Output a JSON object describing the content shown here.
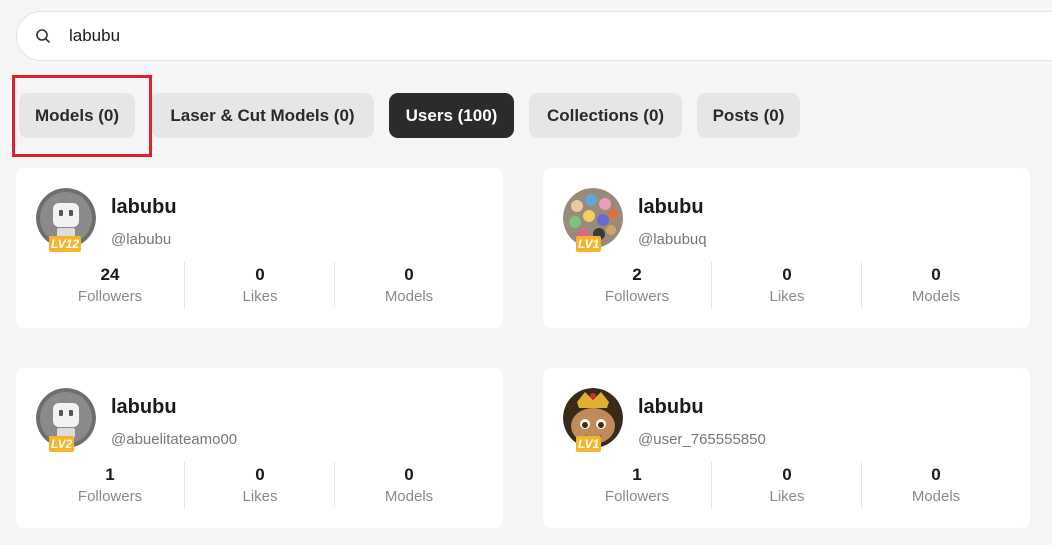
{
  "search": {
    "value": "labubu"
  },
  "tabs": [
    {
      "label": "Models (0)",
      "active": false
    },
    {
      "label": "Laser & Cut Models (0)",
      "active": false
    },
    {
      "label": "Users (100)",
      "active": true
    },
    {
      "label": "Collections (0)",
      "active": false
    },
    {
      "label": "Posts (0)",
      "active": false
    }
  ],
  "users": [
    {
      "name": "labubu",
      "handle": "@labubu",
      "level": "LV12",
      "followers": "24",
      "likes": "0",
      "models": "0",
      "avatar": "robot-avatar"
    },
    {
      "name": "labubu",
      "handle": "@labubuq",
      "level": "LV1",
      "followers": "2",
      "likes": "0",
      "models": "0",
      "avatar": "photo-avatar"
    },
    {
      "name": "labubu",
      "handle": "@abuelitateamo00",
      "level": "LV2",
      "followers": "1",
      "likes": "0",
      "models": "0",
      "avatar": "robot-avatar"
    },
    {
      "name": "labubu",
      "handle": "@user_765555850",
      "level": "LV1",
      "followers": "1",
      "likes": "0",
      "models": "0",
      "avatar": "photo-avatar"
    }
  ],
  "stat_labels": {
    "followers": "Followers",
    "likes": "Likes",
    "models": "Models"
  },
  "colors": {
    "active_tab": "#2b2b2b",
    "tab": "#e6e6e6",
    "highlight": "#e0202a",
    "level_badge": "#f5b42a"
  }
}
